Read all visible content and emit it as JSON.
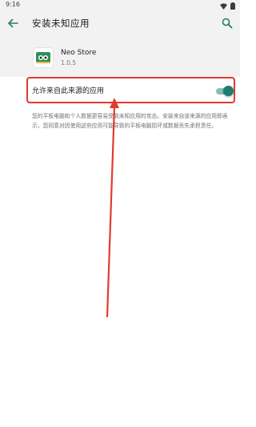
{
  "status_bar": {
    "time": "9:16",
    "icons": [
      "wifi-icon",
      "battery-icon"
    ]
  },
  "app_bar": {
    "title": "安装未知应用",
    "back_icon": "arrow-back-icon",
    "search_icon": "search-icon"
  },
  "app": {
    "name": "Neo Store",
    "version": "1.0.5",
    "icon": "neo-store-icon"
  },
  "setting": {
    "label": "允许来自此来源的应用",
    "enabled": true
  },
  "warning_text": "您的平板电脑和个人数据更容易受到未知应用的攻击。安装来自该来源的应用即表示，您同意对因使用这些应用可能导致的平板电脑损坏或数据丢失承担责任。",
  "colors": {
    "accent": "#1e7d6e",
    "annotation": "#e33a2f",
    "header_background": "#f2f2f2"
  }
}
